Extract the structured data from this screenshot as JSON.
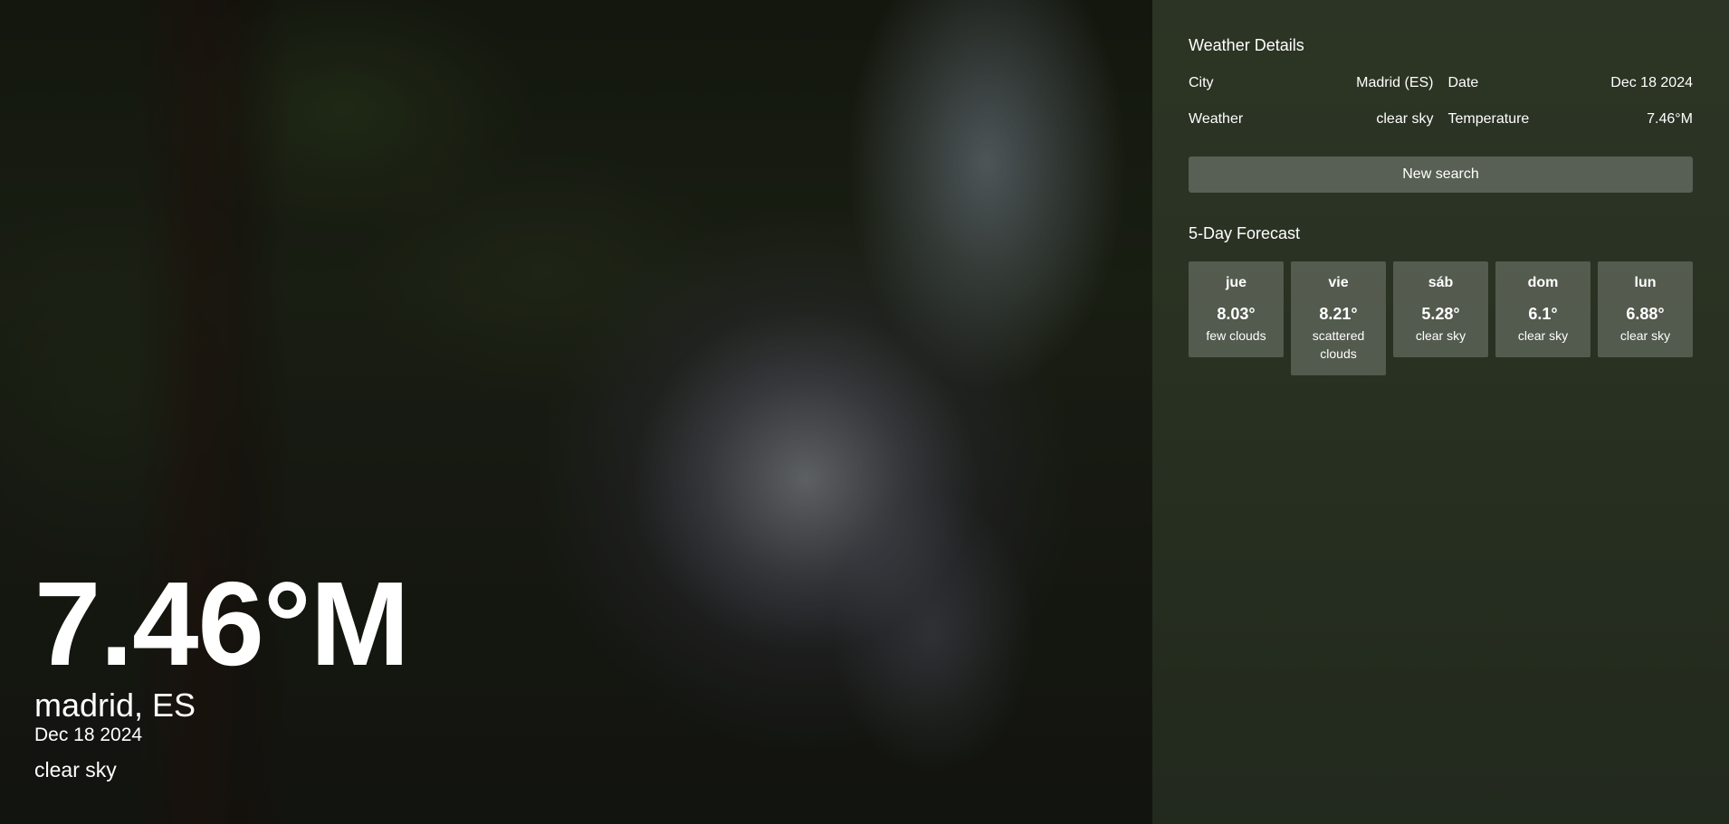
{
  "hero": {
    "temperature": "7.46°M",
    "city": "madrid, ES",
    "date": "Dec 18 2024",
    "description": "clear sky"
  },
  "details": {
    "title": "Weather Details",
    "city_label": "City",
    "city_value": "Madrid (ES)",
    "date_label": "Date",
    "date_value": "Dec 18 2024",
    "weather_label": "Weather",
    "weather_value": "clear sky",
    "temperature_label": "Temperature",
    "temperature_value": "7.46°M",
    "new_search_label": "New search"
  },
  "forecast": {
    "title": "5-Day Forecast",
    "days": [
      {
        "day": "jue",
        "temp": "8.03°",
        "desc": "few clouds"
      },
      {
        "day": "vie",
        "temp": "8.21°",
        "desc": "scattered clouds"
      },
      {
        "day": "sáb",
        "temp": "5.28°",
        "desc": "clear sky"
      },
      {
        "day": "dom",
        "temp": "6.1°",
        "desc": "clear sky"
      },
      {
        "day": "lun",
        "temp": "6.88°",
        "desc": "clear sky"
      }
    ]
  },
  "colors": {
    "text": "#ffffff",
    "card_bg": "rgba(255,255,255,0.2)",
    "button_bg": "rgba(255,255,255,0.22)"
  }
}
